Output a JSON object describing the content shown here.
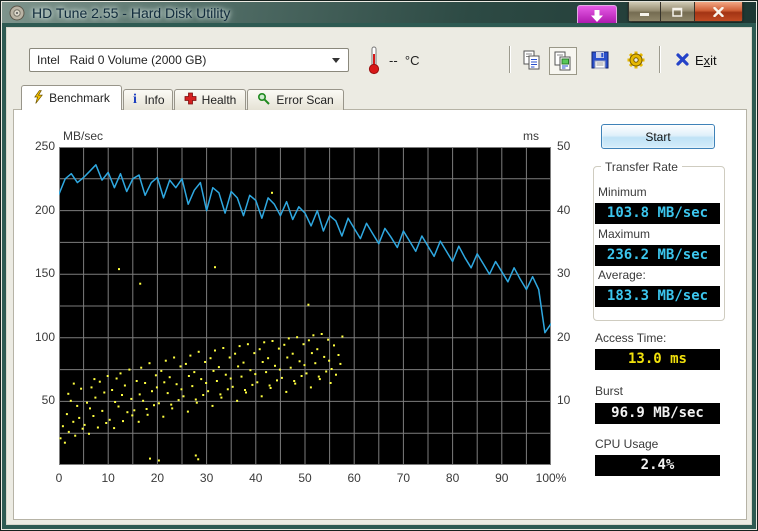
{
  "window": {
    "title": "HD Tune 2.55 - Hard Disk Utility"
  },
  "titlebar": {
    "download_button": "download-overlay",
    "minimize": "minimize",
    "maximize": "maximize",
    "close": "close"
  },
  "toolbar": {
    "drive_select": "Intel   Raid 0 Volume (2000 GB)",
    "temperature": "--  °C",
    "exit": {
      "pre": "E",
      "mnemonic": "x",
      "post": "it"
    }
  },
  "tabs": [
    {
      "label": "Benchmark",
      "active": true
    },
    {
      "label": "Info",
      "active": false
    },
    {
      "label": "Health",
      "active": false
    },
    {
      "label": "Error Scan",
      "active": false
    }
  ],
  "panel": {
    "start_label": "Start",
    "transfer_rate": {
      "title": "Transfer Rate",
      "minimum_label": "Minimum",
      "minimum_value": "103.8 MB/sec",
      "maximum_label": "Maximum",
      "maximum_value": "236.2 MB/sec",
      "average_label": "Average:",
      "average_value": "183.3 MB/sec"
    },
    "access_time_label": "Access Time:",
    "access_time_value": "13.0 ms",
    "burst_label": "Burst",
    "burst_value": "96.9 MB/sec",
    "cpu_label": "CPU Usage",
    "cpu_value": "2.4%",
    "colors": {
      "rate_lcd": "#3cc6ee",
      "access_lcd": "#f2e20c",
      "white_lcd": "#f2f2f2"
    }
  },
  "chart_data": {
    "type": "line+scatter",
    "left_axis": {
      "label": "MB/sec",
      "min": 0,
      "max": 250,
      "ticks": [
        250,
        200,
        150,
        100,
        50
      ]
    },
    "right_axis": {
      "label": "ms",
      "min": 0,
      "max": 50,
      "ticks": [
        50,
        40,
        30,
        20,
        10
      ]
    },
    "x_axis": {
      "min": 0,
      "max": 100,
      "tick_step": 10,
      "ticks": [
        "0",
        "10",
        "20",
        "30",
        "40",
        "50",
        "60",
        "70",
        "80",
        "90",
        "100%"
      ]
    },
    "grid": {
      "x_step_pct": 5,
      "y_step": 25,
      "color": "#7d7d7d",
      "background": "#000000"
    },
    "series": [
      {
        "name": "transfer_rate",
        "type": "line",
        "unit": "MB/sec",
        "axis": "left",
        "color": "#2fa8e0",
        "x_start_pct": 0,
        "x_step_pct": 1.25,
        "values": [
          213,
          225,
          229,
          222,
          226,
          231,
          236,
          224,
          230,
          218,
          229,
          215,
          225,
          228,
          212,
          222,
          226,
          210,
          224,
          218,
          225,
          205,
          216,
          222,
          200,
          218,
          214,
          198,
          215,
          210,
          196,
          212,
          208,
          194,
          210,
          205,
          196,
          207,
          193,
          203,
          198,
          188,
          200,
          184,
          196,
          192,
          180,
          194,
          186,
          178,
          190,
          182,
          174,
          186,
          179,
          171,
          184,
          176,
          168,
          180,
          172,
          164,
          176,
          168,
          160,
          172,
          163,
          155,
          166,
          158,
          150,
          160,
          152,
          144,
          155,
          146,
          138,
          148,
          138,
          104,
          111
        ]
      },
      {
        "name": "access_time",
        "type": "scatter",
        "unit": "ms",
        "axis": "right",
        "color": "#ffff40",
        "points": [
          [
            0.3,
            4.2
          ],
          [
            0.8,
            6.1
          ],
          [
            1.2,
            3.5
          ],
          [
            1.6,
            8.0
          ],
          [
            2.0,
            5.2
          ],
          [
            2.4,
            10.1
          ],
          [
            2.9,
            6.8
          ],
          [
            3.3,
            4.6
          ],
          [
            3.7,
            9.3
          ],
          [
            4.1,
            7.4
          ],
          [
            4.5,
            12.0
          ],
          [
            4.8,
            5.7
          ],
          [
            1.9,
            11.2
          ],
          [
            3.0,
            12.8
          ],
          [
            5.2,
            6.3
          ],
          [
            5.7,
            9.8
          ],
          [
            6.1,
            4.9
          ],
          [
            6.6,
            12.2
          ],
          [
            7.0,
            7.7
          ],
          [
            7.4,
            10.6
          ],
          [
            7.9,
            5.9
          ],
          [
            8.3,
            13.1
          ],
          [
            8.8,
            8.5
          ],
          [
            9.2,
            11.4
          ],
          [
            9.6,
            6.6
          ],
          [
            9.9,
            14.0
          ],
          [
            7.2,
            13.5
          ],
          [
            6.3,
            8.9
          ],
          [
            10.3,
            7.1
          ],
          [
            10.8,
            11.8
          ],
          [
            11.2,
            5.8
          ],
          [
            11.7,
            13.6
          ],
          [
            12.1,
            9.2
          ],
          [
            12.5,
            14.4
          ],
          [
            13.0,
            6.9
          ],
          [
            13.4,
            12.5
          ],
          [
            13.9,
            8.3
          ],
          [
            14.3,
            15.0
          ],
          [
            14.7,
            10.4
          ],
          [
            14.9,
            7.8
          ],
          [
            12.8,
            11.0
          ],
          [
            11.4,
            9.9
          ],
          [
            15.3,
            8.6
          ],
          [
            15.8,
            13.2
          ],
          [
            16.2,
            6.8
          ],
          [
            16.7,
            15.3
          ],
          [
            17.1,
            10.1
          ],
          [
            17.5,
            12.9
          ],
          [
            18.0,
            7.9
          ],
          [
            18.4,
            16.0
          ],
          [
            18.9,
            11.6
          ],
          [
            19.3,
            9.4
          ],
          [
            19.7,
            14.1
          ],
          [
            19.9,
            12.2
          ],
          [
            17.8,
            8.8
          ],
          [
            16.4,
            11.1
          ],
          [
            20.3,
            9.7
          ],
          [
            20.8,
            14.8
          ],
          [
            21.2,
            7.6
          ],
          [
            21.7,
            16.4
          ],
          [
            22.1,
            11.3
          ],
          [
            22.5,
            13.8
          ],
          [
            23.0,
            8.9
          ],
          [
            23.4,
            16.9
          ],
          [
            23.9,
            12.7
          ],
          [
            24.3,
            10.2
          ],
          [
            24.7,
            15.5
          ],
          [
            24.9,
            11.9
          ],
          [
            22.8,
            9.5
          ],
          [
            21.4,
            13.0
          ],
          [
            25.3,
            10.8
          ],
          [
            25.8,
            15.9
          ],
          [
            26.2,
            8.4
          ],
          [
            26.7,
            17.2
          ],
          [
            27.1,
            12.4
          ],
          [
            27.5,
            14.6
          ],
          [
            28.0,
            9.8
          ],
          [
            28.4,
            17.8
          ],
          [
            28.9,
            13.5
          ],
          [
            29.3,
            11.0
          ],
          [
            29.7,
            16.2
          ],
          [
            29.9,
            12.9
          ],
          [
            27.8,
            10.3
          ],
          [
            26.4,
            14.0
          ],
          [
            30.3,
            11.6
          ],
          [
            30.8,
            16.8
          ],
          [
            31.2,
            9.3
          ],
          [
            31.7,
            18.0
          ],
          [
            32.1,
            13.2
          ],
          [
            32.5,
            15.4
          ],
          [
            33.0,
            10.6
          ],
          [
            33.4,
            18.4
          ],
          [
            33.9,
            14.2
          ],
          [
            34.3,
            11.9
          ],
          [
            34.7,
            16.9
          ],
          [
            34.9,
            13.6
          ],
          [
            32.8,
            11.1
          ],
          [
            31.4,
            14.8
          ],
          [
            35.3,
            12.3
          ],
          [
            35.8,
            17.5
          ],
          [
            36.2,
            10.1
          ],
          [
            36.7,
            18.7
          ],
          [
            37.1,
            13.9
          ],
          [
            37.5,
            16.1
          ],
          [
            38.0,
            11.4
          ],
          [
            38.4,
            19.0
          ],
          [
            38.9,
            14.9
          ],
          [
            39.3,
            12.6
          ],
          [
            39.7,
            17.6
          ],
          [
            39.9,
            14.3
          ],
          [
            37.8,
            11.8
          ],
          [
            36.4,
            15.5
          ],
          [
            40.3,
            13.0
          ],
          [
            40.8,
            18.2
          ],
          [
            41.2,
            10.8
          ],
          [
            41.7,
            19.3
          ],
          [
            42.1,
            14.6
          ],
          [
            42.5,
            16.8
          ],
          [
            43.0,
            12.1
          ],
          [
            43.4,
            19.5
          ],
          [
            43.9,
            15.6
          ],
          [
            44.3,
            13.3
          ],
          [
            44.7,
            18.3
          ],
          [
            44.9,
            15.0
          ],
          [
            42.8,
            12.5
          ],
          [
            41.4,
            16.2
          ],
          [
            45.3,
            13.7
          ],
          [
            45.8,
            18.9
          ],
          [
            46.2,
            11.5
          ],
          [
            46.7,
            19.9
          ],
          [
            47.1,
            15.3
          ],
          [
            47.5,
            17.5
          ],
          [
            48.0,
            12.8
          ],
          [
            48.4,
            20.1
          ],
          [
            48.9,
            16.3
          ],
          [
            49.3,
            14.0
          ],
          [
            49.7,
            19.0
          ],
          [
            49.9,
            15.7
          ],
          [
            47.8,
            13.2
          ],
          [
            46.4,
            16.9
          ],
          [
            50.3,
            14.4
          ],
          [
            50.8,
            19.6
          ],
          [
            51.2,
            12.2
          ],
          [
            51.7,
            20.4
          ],
          [
            52.1,
            16.0
          ],
          [
            52.5,
            18.2
          ],
          [
            53.0,
            13.5
          ],
          [
            53.4,
            20.6
          ],
          [
            53.9,
            17.0
          ],
          [
            54.3,
            14.7
          ],
          [
            54.7,
            19.7
          ],
          [
            54.9,
            16.4
          ],
          [
            52.8,
            13.9
          ],
          [
            51.4,
            17.6
          ],
          [
            55.4,
            15.1
          ],
          [
            55.9,
            18.8
          ],
          [
            56.3,
            14.2
          ],
          [
            56.8,
            17.3
          ],
          [
            57.2,
            15.9
          ],
          [
            57.6,
            20.2
          ],
          [
            55.2,
            12.9
          ],
          [
            31.7,
            31.1
          ],
          [
            43.3,
            42.8
          ],
          [
            50.7,
            25.2
          ],
          [
            12.2,
            30.8
          ],
          [
            16.5,
            28.5
          ],
          [
            18.5,
            1.0
          ],
          [
            20.3,
            0.7
          ],
          [
            27.8,
            1.5
          ],
          [
            28.3,
            0.9
          ]
        ]
      }
    ]
  }
}
